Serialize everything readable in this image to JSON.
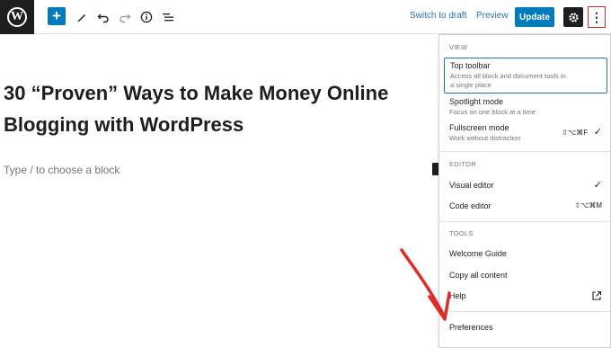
{
  "toolbar": {
    "logo_letter": "W",
    "add_symbol": "+",
    "switch_to_draft": "Switch to draft",
    "preview": "Preview",
    "update": "Update",
    "more_symbol": "⋮"
  },
  "editor": {
    "title": "30 “Proven” Ways to Make Money Online Blogging with WordPress",
    "placeholder": "Type / to choose a block"
  },
  "menu": {
    "view": {
      "label": "VIEW",
      "items": [
        {
          "label": "Top toolbar",
          "desc": "Access all block and document tools in a single place"
        },
        {
          "label": "Spotlight mode",
          "desc": "Focus on one block at a time"
        },
        {
          "label": "Fullscreen mode",
          "desc": "Work without distraction",
          "shortcut": "⇧⌥⌘F",
          "check": "✓"
        }
      ]
    },
    "editor": {
      "label": "EDITOR",
      "items": [
        {
          "label": "Visual editor",
          "check": "✓"
        },
        {
          "label": "Code editor",
          "shortcut": "⇧⌥⌘M"
        }
      ]
    },
    "tools": {
      "label": "TOOLS",
      "items": [
        {
          "label": "Welcome Guide"
        },
        {
          "label": "Copy all content"
        },
        {
          "label": "Help"
        }
      ]
    },
    "preferences": "Preferences"
  },
  "colors": {
    "accent": "#007cba",
    "annotation": "#e02b2b",
    "dark": "#1e1e1e"
  }
}
